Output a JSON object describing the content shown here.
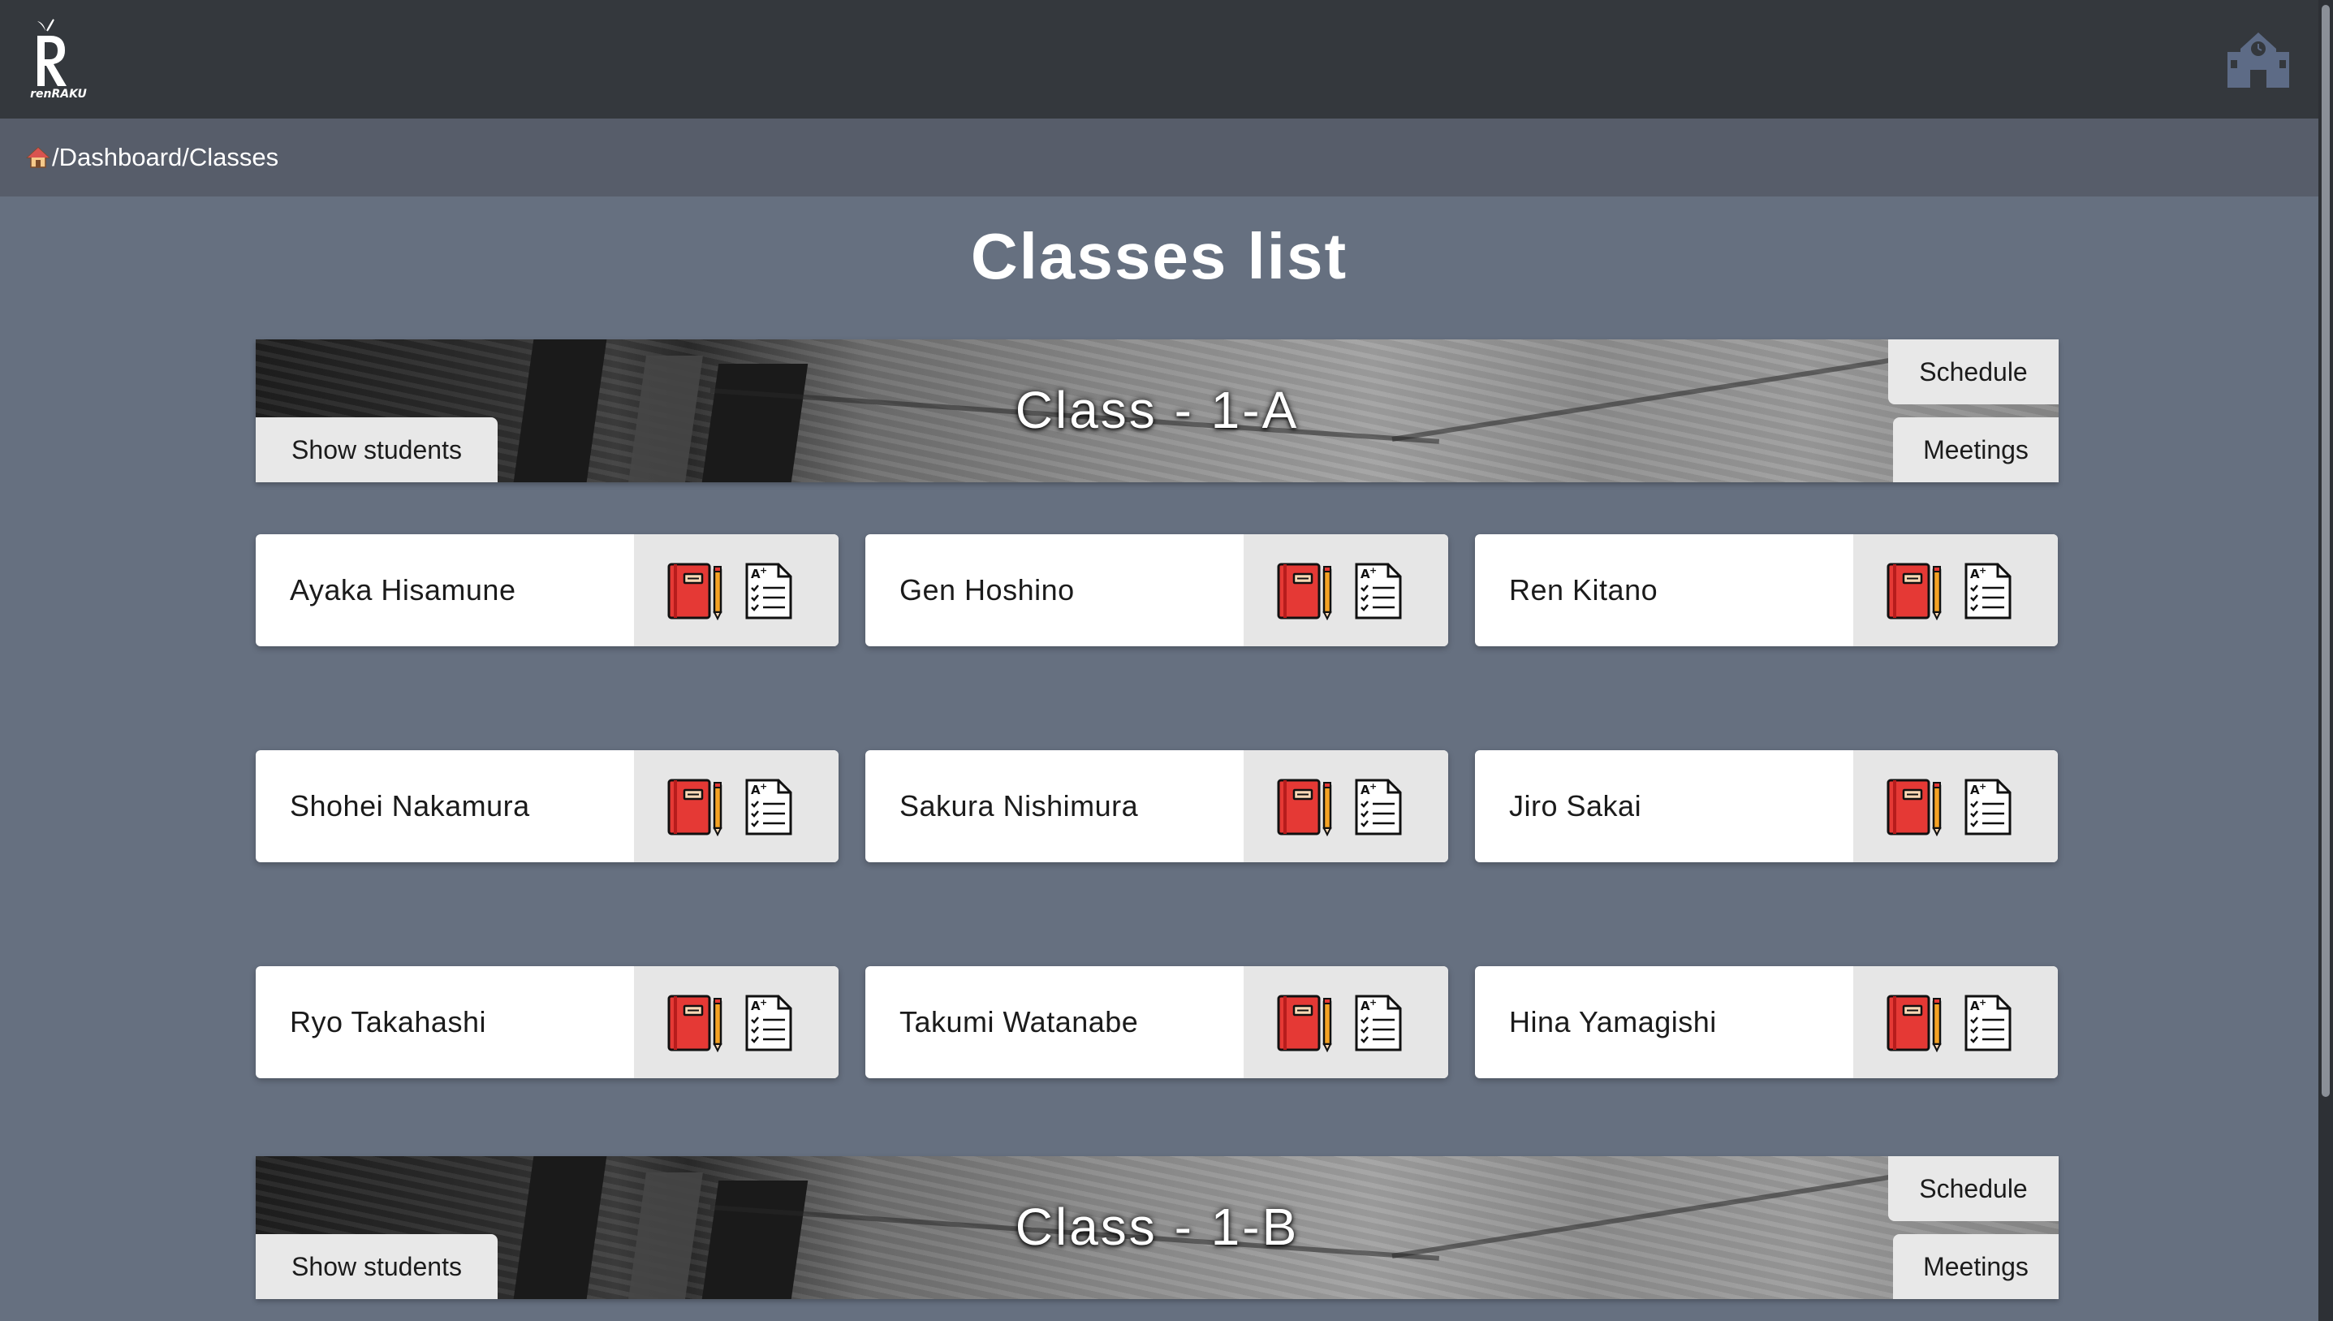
{
  "app": {
    "logo_text": "renRAKU",
    "school_icon": "school-building-icon"
  },
  "breadcrumb": {
    "home_icon": "house-icon",
    "path": "/Dashboard/Classes"
  },
  "page_title": "Classes list",
  "classes": [
    {
      "title": "Class - 1-A",
      "show_students_label": "Show students",
      "schedule_label": "Schedule",
      "meetings_label": "Meetings",
      "students": [
        "Ayaka Hisamune",
        "Gen Hoshino",
        "Ren Kitano",
        "Shohei Nakamura",
        "Sakura Nishimura",
        "Jiro Sakai",
        "Ryo Takahashi",
        "Takumi Watanabe",
        "Hina Yamagishi"
      ]
    },
    {
      "title": "Class - 1-B",
      "show_students_label": "Show students",
      "schedule_label": "Schedule",
      "meetings_label": "Meetings",
      "students": []
    }
  ],
  "student_action_icons": [
    "notebook-icon",
    "grade-sheet-icon"
  ],
  "colors": {
    "navbar": "#34383d",
    "breadcrumb_bar": "#575d6a",
    "page_background": "#667080",
    "card_action_bg": "#e6e6e6",
    "notebook_red": "#e53935"
  }
}
